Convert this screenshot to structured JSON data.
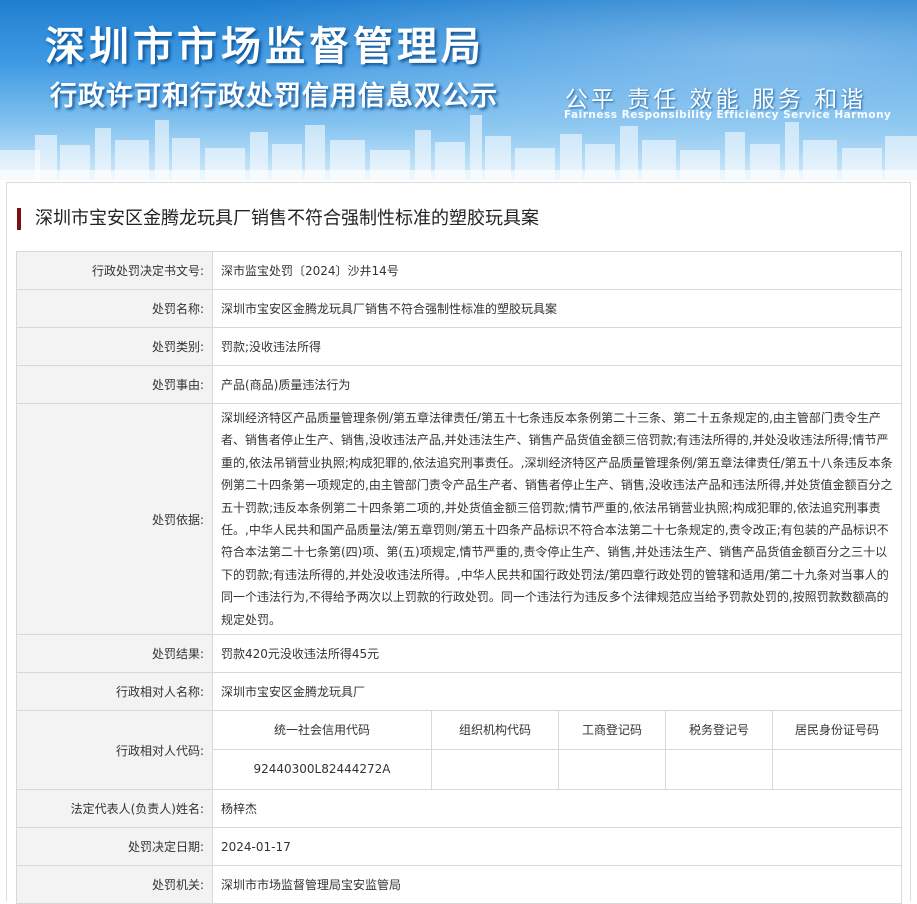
{
  "banner": {
    "org_title": "深圳市市场监督管理局",
    "sub_title": "行政许可和行政处罚信用信息双公示",
    "slogan": "公平  责任  效能  服务  和谐",
    "slogan_en": "Fairness Responsibility Efficiency Service Harmony"
  },
  "case_title": "深圳市宝安区金腾龙玩具厂销售不符合强制性标准的塑胶玩具案",
  "fields": {
    "decision_no": {
      "label": "行政处罚决定书文号:",
      "value": "深市监宝处罚〔2024〕沙井14号"
    },
    "penalty_name": {
      "label": "处罚名称:",
      "value": "深圳市宝安区金腾龙玩具厂销售不符合强制性标准的塑胶玩具案"
    },
    "penalty_type": {
      "label": "处罚类别:",
      "value": "罚款;没收违法所得"
    },
    "penalty_reason": {
      "label": "处罚事由:",
      "value": "产品(商品)质量违法行为"
    },
    "penalty_basis": {
      "label": "处罚依据:",
      "value": "深圳经济特区产品质量管理条例/第五章法律责任/第五十七条违反本条例第二十三条、第二十五条规定的,由主管部门责令生产者、销售者停止生产、销售,没收违法产品,并处违法生产、销售产品货值金额三倍罚款;有违法所得的,并处没收违法所得;情节严重的,依法吊销营业执照;构成犯罪的,依法追究刑事责任。,深圳经济特区产品质量管理条例/第五章法律责任/第五十八条违反本条例第二十四条第一项规定的,由主管部门责令产品生产者、销售者停止生产、销售,没收违法产品和违法所得,并处货值金额百分之五十罚款;违反本条例第二十四条第二项的,并处货值金额三倍罚款;情节严重的,依法吊销营业执照;构成犯罪的,依法追究刑事责任。,中华人民共和国产品质量法/第五章罚则/第五十四条产品标识不符合本法第二十七条规定的,责令改正;有包装的产品标识不符合本法第二十七条第(四)项、第(五)项规定,情节严重的,责令停止生产、销售,并处违法生产、销售产品货值金额百分之三十以下的罚款;有违法所得的,并处没收违法所得。,中华人民共和国行政处罚法/第四章行政处罚的管辖和适用/第二十九条对当事人的同一个违法行为,不得给予两次以上罚款的行政处罚。同一个违法行为违反多个法律规范应当给予罚款处罚的,按照罚款数额高的规定处罚。"
    },
    "penalty_result": {
      "label": "处罚结果:",
      "value": "罚款420元没收违法所得45元"
    },
    "party_name": {
      "label": "行政相对人名称:",
      "value": "深圳市宝安区金腾龙玩具厂"
    },
    "party_code": {
      "label": "行政相对人代码:",
      "headers": {
        "uscc": "统一社会信用代码",
        "org_code": "组织机构代码",
        "business_reg": "工商登记码",
        "tax_reg": "税务登记号",
        "id_no": "居民身份证号码"
      },
      "values": {
        "uscc": "92440300L82444272A",
        "org_code": "",
        "business_reg": "",
        "tax_reg": "",
        "id_no": ""
      }
    },
    "legal_rep": {
      "label": "法定代表人(负责人)姓名:",
      "value": "杨梓杰"
    },
    "decision_date": {
      "label": "处罚决定日期:",
      "value": "2024-01-17"
    },
    "authority": {
      "label": "处罚机关:",
      "value": "深圳市市场监督管理局宝安监管局"
    }
  },
  "colors": {
    "title_mark": "#7a1212",
    "label_bg": "#f3f3f3",
    "border": "#d8d8d8",
    "banner_blue": "#1f7fd0"
  }
}
